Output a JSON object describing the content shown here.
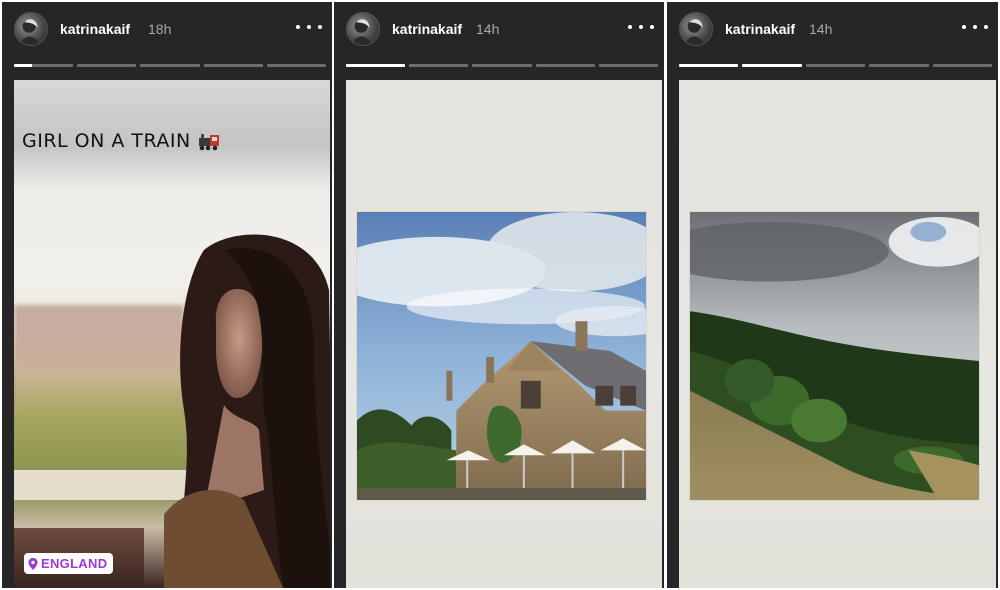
{
  "stories": [
    {
      "username": "katrinakaif",
      "time": "18h",
      "progress": {
        "segments": 5,
        "active_index": 0,
        "active_fill": 0.3
      },
      "caption": "GIRL ON A TRAIN",
      "caption_icon": "train-emoji-icon",
      "location_sticker": "ENGLAND",
      "photo": "woman-on-train-photo"
    },
    {
      "username": "katrinakaif",
      "time": "14h",
      "progress": {
        "segments": 5,
        "active_index": 0,
        "active_fill": 1.0
      },
      "photo": "country-manor-house-photo"
    },
    {
      "username": "katrinakaif",
      "time": "14h",
      "progress": {
        "segments": 5,
        "active_index": 1,
        "active_fill": 1.0
      },
      "photo": "green-hillside-photo"
    }
  ],
  "colors": {
    "panel_bg": "#262626",
    "progress_track": "#6e6e6e",
    "progress_fill": "#ffffff",
    "location_text": "#9a3ad4"
  },
  "icons": {
    "more": "more-options-icon",
    "avatar": "profile-avatar"
  }
}
